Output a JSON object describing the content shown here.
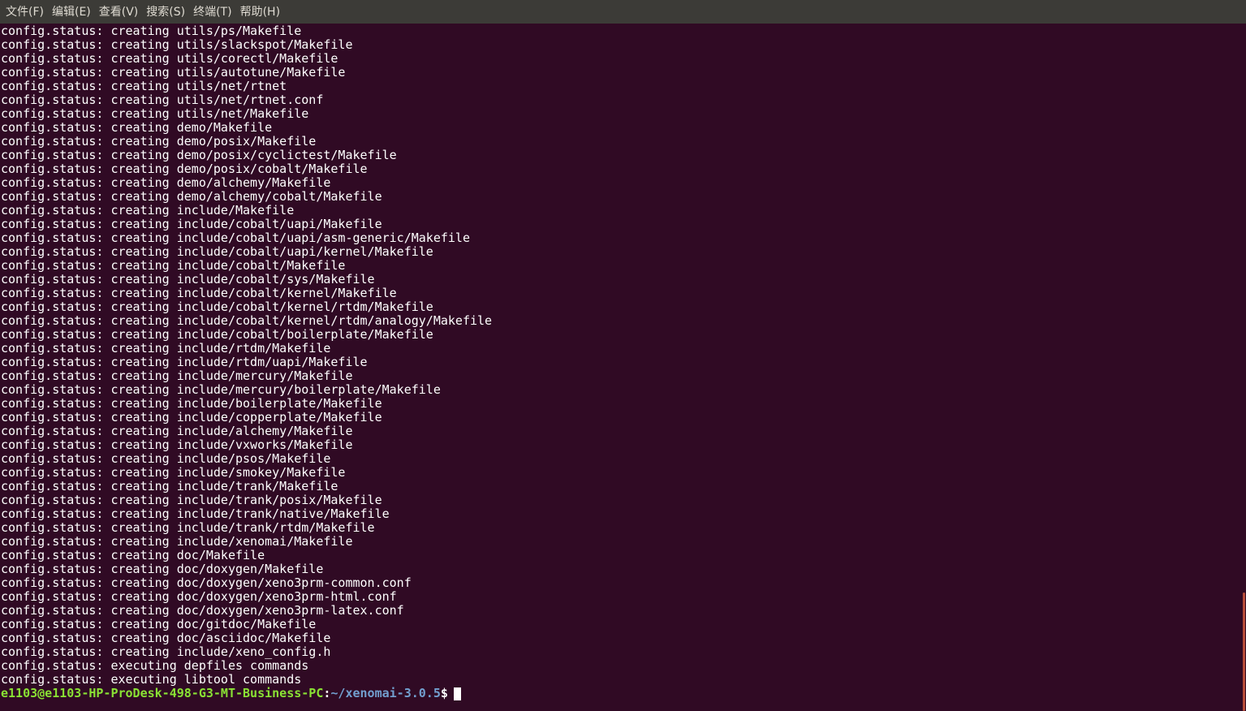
{
  "menubar": {
    "items": [
      {
        "label": "文件(F)"
      },
      {
        "label": "编辑(E)"
      },
      {
        "label": "查看(V)"
      },
      {
        "label": "搜索(S)"
      },
      {
        "label": "终端(T)"
      },
      {
        "label": "帮助(H)"
      }
    ]
  },
  "terminal": {
    "lines": [
      "config.status: creating utils/ps/Makefile",
      "config.status: creating utils/slackspot/Makefile",
      "config.status: creating utils/corectl/Makefile",
      "config.status: creating utils/autotune/Makefile",
      "config.status: creating utils/net/rtnet",
      "config.status: creating utils/net/rtnet.conf",
      "config.status: creating utils/net/Makefile",
      "config.status: creating demo/Makefile",
      "config.status: creating demo/posix/Makefile",
      "config.status: creating demo/posix/cyclictest/Makefile",
      "config.status: creating demo/posix/cobalt/Makefile",
      "config.status: creating demo/alchemy/Makefile",
      "config.status: creating demo/alchemy/cobalt/Makefile",
      "config.status: creating include/Makefile",
      "config.status: creating include/cobalt/uapi/Makefile",
      "config.status: creating include/cobalt/uapi/asm-generic/Makefile",
      "config.status: creating include/cobalt/uapi/kernel/Makefile",
      "config.status: creating include/cobalt/Makefile",
      "config.status: creating include/cobalt/sys/Makefile",
      "config.status: creating include/cobalt/kernel/Makefile",
      "config.status: creating include/cobalt/kernel/rtdm/Makefile",
      "config.status: creating include/cobalt/kernel/rtdm/analogy/Makefile",
      "config.status: creating include/cobalt/boilerplate/Makefile",
      "config.status: creating include/rtdm/Makefile",
      "config.status: creating include/rtdm/uapi/Makefile",
      "config.status: creating include/mercury/Makefile",
      "config.status: creating include/mercury/boilerplate/Makefile",
      "config.status: creating include/boilerplate/Makefile",
      "config.status: creating include/copperplate/Makefile",
      "config.status: creating include/alchemy/Makefile",
      "config.status: creating include/vxworks/Makefile",
      "config.status: creating include/psos/Makefile",
      "config.status: creating include/smokey/Makefile",
      "config.status: creating include/trank/Makefile",
      "config.status: creating include/trank/posix/Makefile",
      "config.status: creating include/trank/native/Makefile",
      "config.status: creating include/trank/rtdm/Makefile",
      "config.status: creating include/xenomai/Makefile",
      "config.status: creating doc/Makefile",
      "config.status: creating doc/doxygen/Makefile",
      "config.status: creating doc/doxygen/xeno3prm-common.conf",
      "config.status: creating doc/doxygen/xeno3prm-html.conf",
      "config.status: creating doc/doxygen/xeno3prm-latex.conf",
      "config.status: creating doc/gitdoc/Makefile",
      "config.status: creating doc/asciidoc/Makefile",
      "config.status: creating include/xeno_config.h",
      "config.status: executing depfiles commands",
      "config.status: executing libtool commands"
    ],
    "prompt": {
      "user_host": "e1103@e1103-HP-ProDesk-498-G3-MT-Business-PC",
      "separator": ":",
      "path": "~/xenomai-3.0.5",
      "symbol": "$"
    }
  },
  "colors": {
    "background": "#300a24",
    "menubar": "#3c3b37",
    "text": "#ffffff",
    "prompt_user": "#8ae234",
    "prompt_path": "#729fcf",
    "scrollbar": "#b84d3a"
  }
}
